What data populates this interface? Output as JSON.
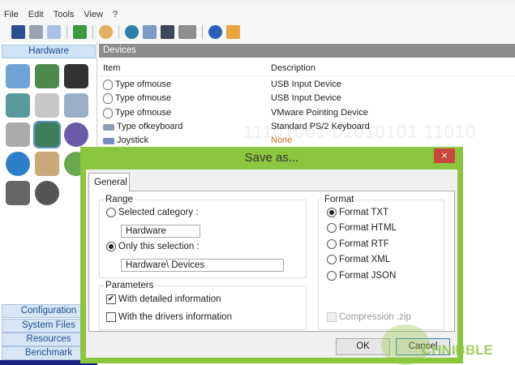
{
  "menu": [
    "File",
    "Edit",
    "Tools",
    "View",
    "?"
  ],
  "toolbar_icons": [
    "save-icon",
    "print-icon",
    "copy-icon",
    "refresh-icon",
    "search-icon",
    "network-icon",
    "hardware-icon",
    "motherboard-icon",
    "camera-dropdown-icon",
    "help-icon",
    "home-icon"
  ],
  "sidebar": {
    "active": "Hardware",
    "items": [
      "Configuration",
      "System Files",
      "Resources",
      "Benchmark"
    ]
  },
  "devices": {
    "title": "Devices",
    "columns": [
      "Item",
      "Description"
    ],
    "rows": [
      {
        "item": "Type ofmouse",
        "desc": "USB Input Device",
        "icon": "mouse-icon"
      },
      {
        "item": "Type ofmouse",
        "desc": "USB Input Device",
        "icon": "mouse-icon"
      },
      {
        "item": "Type ofmouse",
        "desc": "VMware Pointing Device",
        "icon": "mouse-icon"
      },
      {
        "item": "Type ofkeyboard",
        "desc": "Standard PS/2 Keyboard",
        "icon": "keyboard-icon"
      },
      {
        "item": "Joystick",
        "desc": "None",
        "icon": "joystick-icon"
      }
    ],
    "none_color": "#d2691e"
  },
  "dialog": {
    "title": "Save as...",
    "close": "×",
    "tab": "General",
    "range": {
      "label": "Range",
      "selected_category": "Selected category :",
      "category_value": "Hardware",
      "only_selection": "Only this selection :",
      "selection_value": "Hardware\\ Devices",
      "choice": "only_selection"
    },
    "parameters": {
      "label": "Parameters",
      "detailed": "With detailed information",
      "detailed_checked": true,
      "drivers": "With the drivers information",
      "drivers_checked": false
    },
    "format": {
      "label": "Format",
      "options": [
        "Format TXT",
        "Format HTML",
        "Format RTF",
        "Format XML",
        "Format JSON"
      ],
      "selected": "Format TXT",
      "compression": "Compression  .zip"
    },
    "ok": "OK",
    "cancel": "Cancel",
    "accent": "#8cc63f"
  },
  "watermark": "TechNibble"
}
